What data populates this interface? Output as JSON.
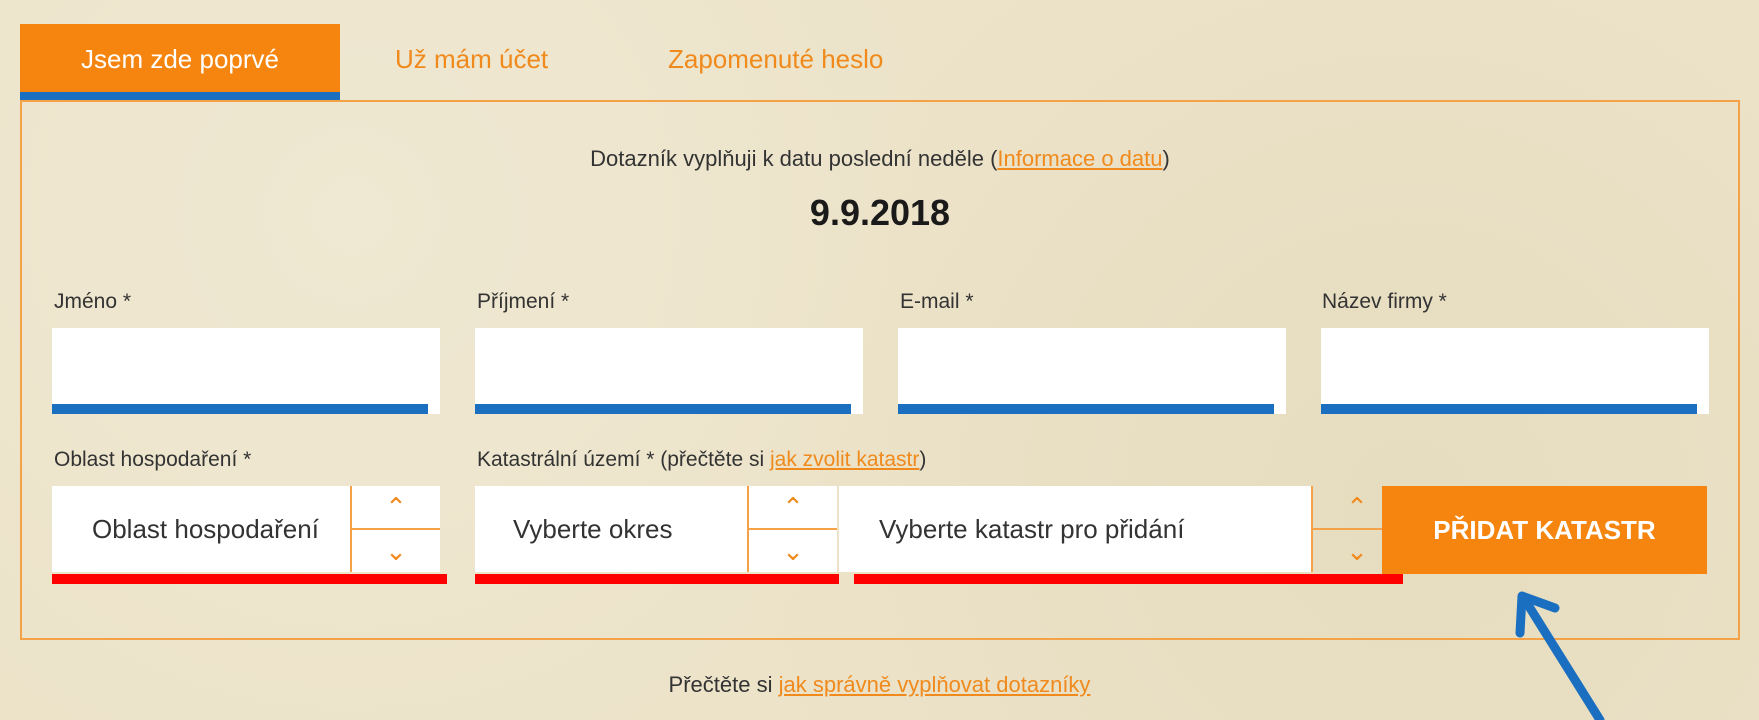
{
  "tabs": [
    {
      "label": "Jsem zde poprvé",
      "active": true
    },
    {
      "label": "Už mám účet",
      "active": false
    },
    {
      "label": "Zapomenuté heslo",
      "active": false
    }
  ],
  "info": {
    "prefix": "Dotazník vyplňuji k datu poslední neděle (",
    "link": "Informace o datu",
    "suffix": ")"
  },
  "date": "9.9.2018",
  "fields": {
    "first_name": {
      "label": "Jméno *",
      "value": ""
    },
    "last_name": {
      "label": "Příjmení *",
      "value": ""
    },
    "email": {
      "label": "E-mail *",
      "value": ""
    },
    "company": {
      "label": "Název firmy *",
      "value": ""
    }
  },
  "area": {
    "label": "Oblast hospodaření *",
    "value": "Oblast hospodaření"
  },
  "cadastre": {
    "label_prefix": "Katastrální území * (přečtěte si ",
    "label_link": "jak zvolit katastr",
    "label_suffix": ")",
    "district_value": "Vyberte okres",
    "cadastre_value": "Vyberte katastr pro přidání"
  },
  "add_button": "PŘIDAT KATASTR",
  "footer": {
    "prefix": "Přečtěte si ",
    "link": "jak správně vyplňovat dotazníky"
  },
  "icons": {
    "up": "chevron-up-icon",
    "down": "chevron-down-icon"
  },
  "colors": {
    "accent": "#f5850e",
    "blue": "#1a6fc0",
    "error": "#ff0000"
  }
}
